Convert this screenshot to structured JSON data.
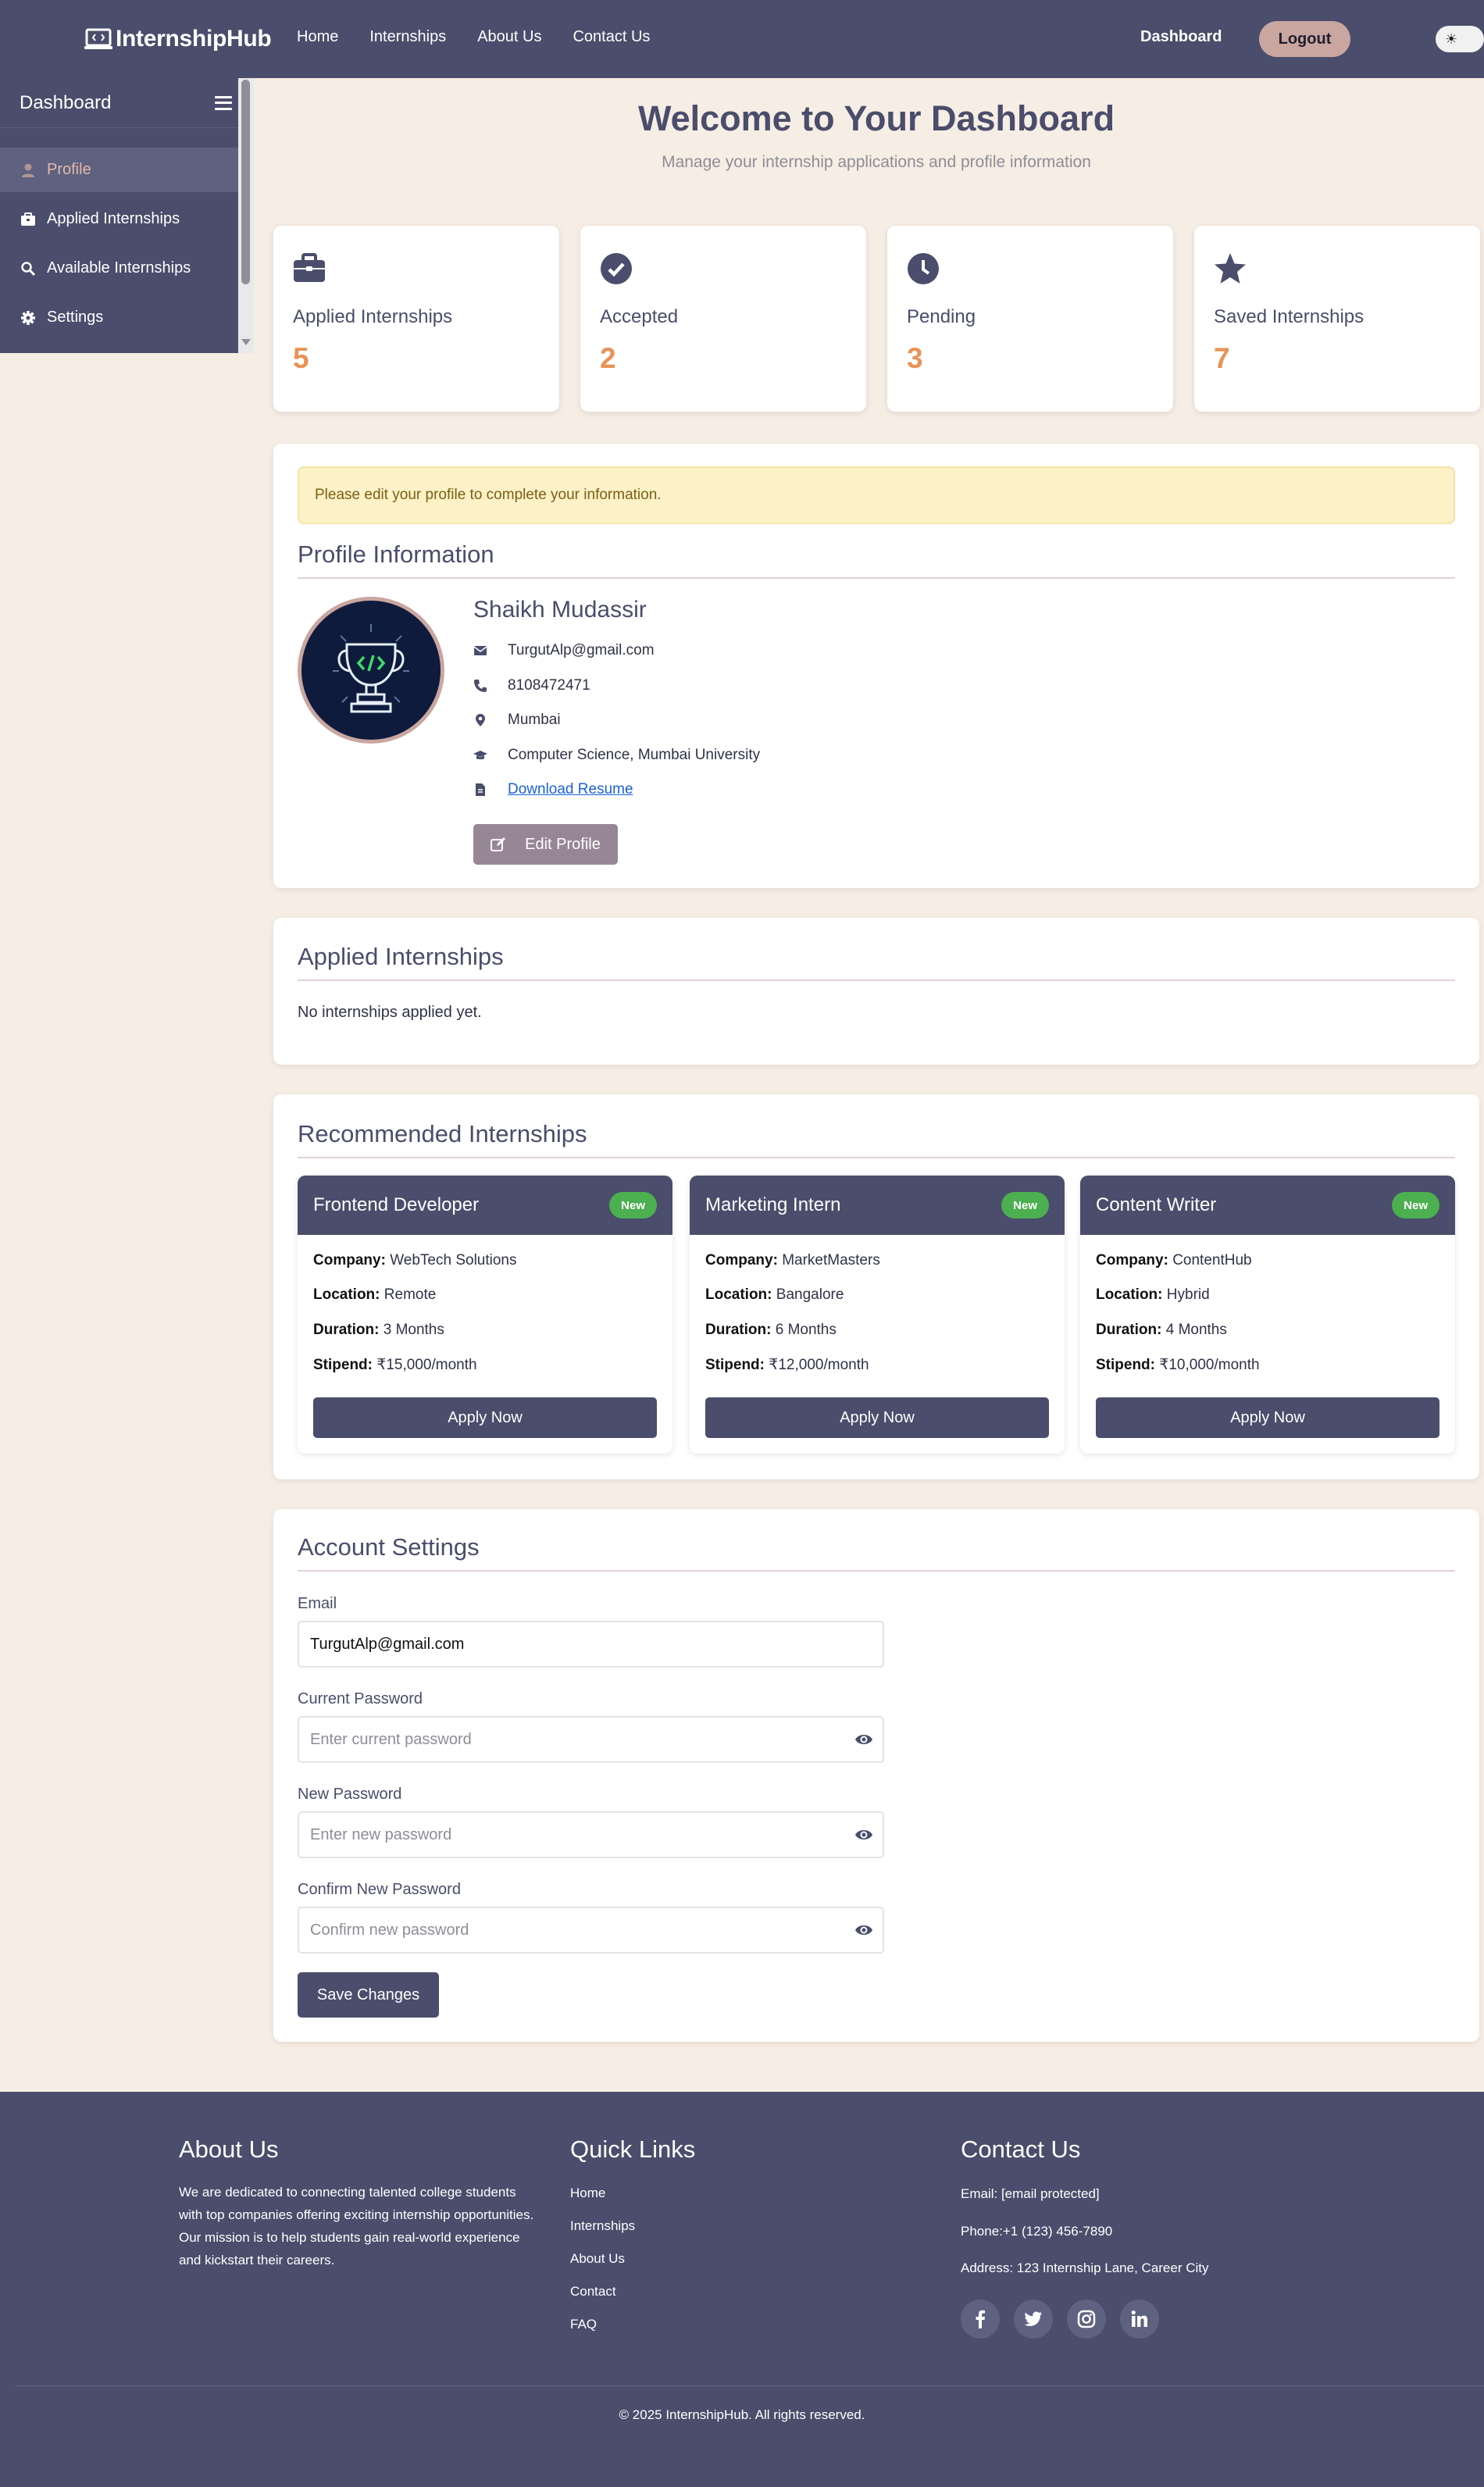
{
  "nav": {
    "brand": "InternshipHub",
    "links": [
      "Home",
      "Internships",
      "About Us",
      "Contact Us"
    ],
    "dashboard": "Dashboard",
    "logout": "Logout",
    "theme_icon": "☀"
  },
  "sidebar": {
    "title": "Dashboard",
    "items": [
      {
        "label": "Profile",
        "icon": "user-icon",
        "active": true
      },
      {
        "label": "Applied Internships",
        "icon": "briefcase-icon"
      },
      {
        "label": "Available Internships",
        "icon": "search-icon"
      },
      {
        "label": "Settings",
        "icon": "gear-icon"
      }
    ]
  },
  "header": {
    "title": "Welcome to Your Dashboard",
    "subtitle": "Manage your internship applications and profile information"
  },
  "stats": [
    {
      "label": "Applied Internships",
      "value": "5",
      "icon": "briefcase-icon"
    },
    {
      "label": "Accepted",
      "value": "2",
      "icon": "check-circle-icon"
    },
    {
      "label": "Pending",
      "value": "3",
      "icon": "clock-icon"
    },
    {
      "label": "Saved Internships",
      "value": "7",
      "icon": "star-icon"
    }
  ],
  "profile": {
    "alert": "Please edit your profile to complete your information.",
    "section_title": "Profile Information",
    "name": "Shaikh Mudassir",
    "email": "TurgutAlp@gmail.com",
    "phone": "8108472471",
    "location": "Mumbai",
    "education": "Computer Science, Mumbai University",
    "resume_link": "Download Resume",
    "edit_button": "Edit Profile"
  },
  "applied": {
    "title": "Applied Internships",
    "empty": "No internships applied yet."
  },
  "recommended": {
    "title": "Recommended Internships",
    "labels": {
      "company": "Company:",
      "location": "Location:",
      "duration": "Duration:",
      "stipend": "Stipend:"
    },
    "badge": "New",
    "apply": "Apply Now",
    "cards": [
      {
        "title": "Frontend Developer",
        "company": "WebTech Solutions",
        "location": "Remote",
        "duration": "3 Months",
        "stipend": "₹15,000/month"
      },
      {
        "title": "Marketing Intern",
        "company": "MarketMasters",
        "location": "Bangalore",
        "duration": "6 Months",
        "stipend": "₹12,000/month"
      },
      {
        "title": "Content Writer",
        "company": "ContentHub",
        "location": "Hybrid",
        "duration": "4 Months",
        "stipend": "₹10,000/month"
      }
    ]
  },
  "settings": {
    "title": "Account Settings",
    "email_label": "Email",
    "email_value": "TurgutAlp@gmail.com",
    "current_label": "Current Password",
    "current_placeholder": "Enter current password",
    "new_label": "New Password",
    "new_placeholder": "Enter new password",
    "confirm_label": "Confirm New Password",
    "confirm_placeholder": "Confirm new password",
    "save": "Save Changes"
  },
  "footer": {
    "about_title": "About Us",
    "about_text": "We are dedicated to connecting talented college students with top companies offering exciting internship opportunities. Our mission is to help students gain real-world experience and kickstart their careers.",
    "links_title": "Quick Links",
    "links": [
      "Home",
      "Internships",
      "About Us",
      "Contact",
      "FAQ"
    ],
    "contact_title": "Contact Us",
    "email": "Email: [email  protected]",
    "phone": "Phone:+1 (123) 456-7890",
    "address": "Address: 123 Internship Lane, Career City",
    "social": [
      "facebook-icon",
      "twitter-icon",
      "instagram-icon",
      "linkedin-icon"
    ],
    "copyright": "© 2025 InternshipHub. All rights reserved."
  },
  "colors": {
    "primary": "#4a4d6b",
    "accent": "#e89355",
    "background": "#f6ede4",
    "badge": "#4caf50"
  }
}
